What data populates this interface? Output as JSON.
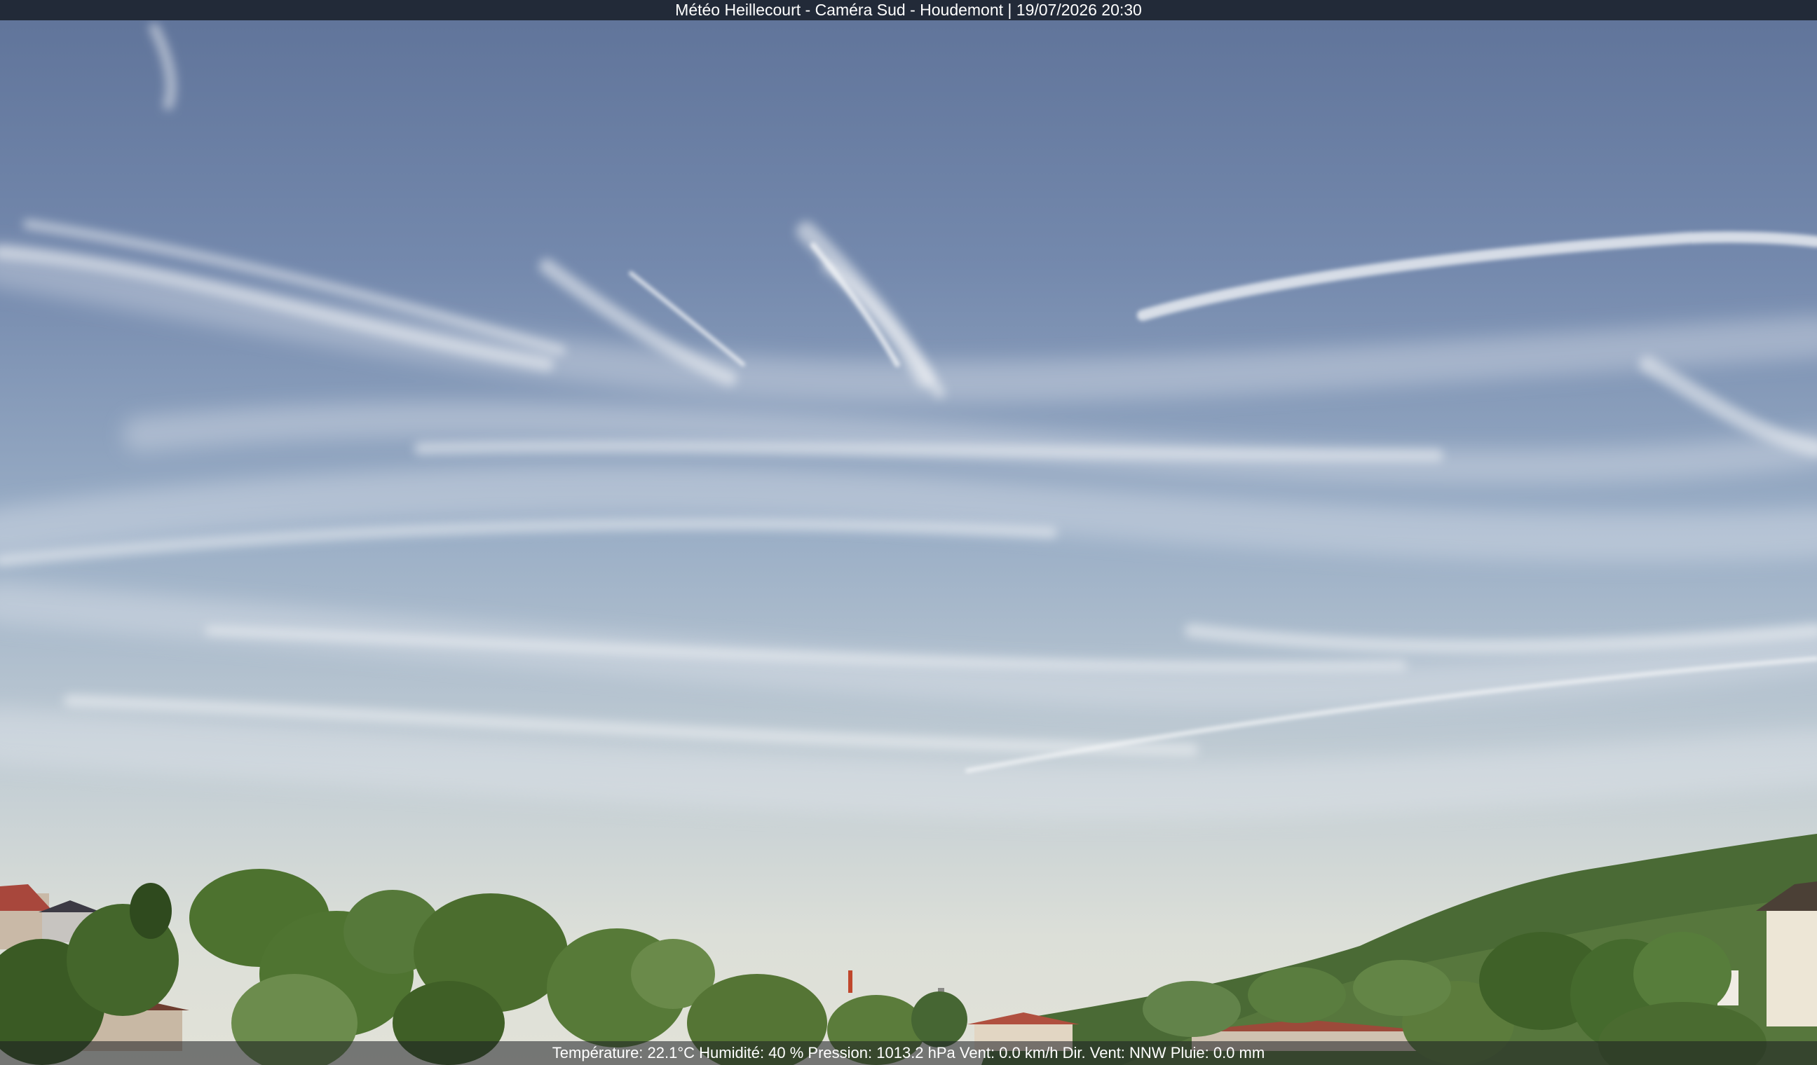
{
  "title_bar": {
    "text": "Météo Heillecourt - Caméra Sud - Houdemont | 19/07/2026 20:30"
  },
  "info_bar": {
    "text": "Température: 22.1°C  Humidité: 40 % Pression: 1013.2 hPa Vent: 0.0 km/h Dir. Vent: NNW Pluie: 0.0 mm"
  },
  "colors": {
    "title_bar_bg": "#222a38",
    "sky_top": "#5f7399",
    "sky_horizon": "#dde0da",
    "vegetation": "#3f6428"
  }
}
